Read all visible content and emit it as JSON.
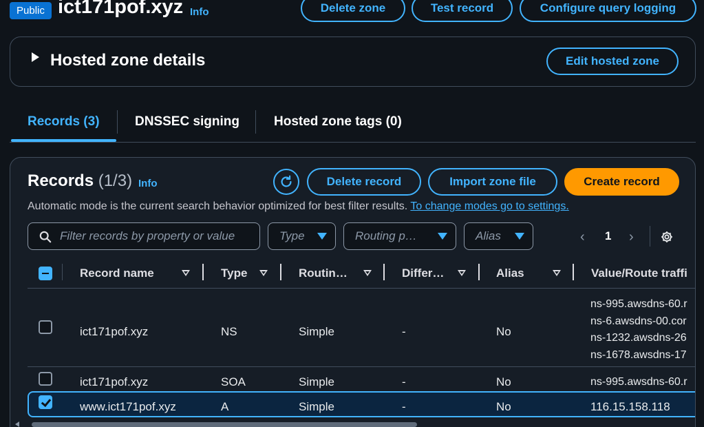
{
  "header": {
    "badge": "Public",
    "zone_name": "ict171pof.xyz",
    "info": "Info",
    "buttons": {
      "delete_zone": "Delete zone",
      "test_record": "Test record",
      "configure_query_logging": "Configure query logging"
    }
  },
  "details_panel": {
    "title": "Hosted zone details",
    "edit_button": "Edit hosted zone"
  },
  "tabs": [
    {
      "label": "Records (3)",
      "active": true
    },
    {
      "label": "DNSSEC signing",
      "active": false
    },
    {
      "label": "Hosted zone tags (0)",
      "active": false
    }
  ],
  "records": {
    "title": "Records",
    "count": "(1/3)",
    "info": "Info",
    "buttons": {
      "delete_record": "Delete record",
      "import_zone_file": "Import zone file",
      "create_record": "Create record"
    },
    "helper_text": "Automatic mode is the current search behavior optimized for best filter results.",
    "helper_link": "To change modes go to settings.",
    "filters": {
      "search_placeholder": "Filter records by property or value",
      "type": "Type",
      "routing": "Routing p…",
      "alias": "Alias"
    },
    "pagination": {
      "current_page": "1"
    },
    "columns": [
      "Record name",
      "Type",
      "Routin…",
      "Differ…",
      "Alias",
      "Value/Route traffi"
    ],
    "rows": [
      {
        "checked": false,
        "name": "ict171pof.xyz",
        "type": "NS",
        "routing": "Simple",
        "differentiator": "-",
        "alias": "No",
        "values": [
          "ns-995.awsdns-60.r",
          "ns-6.awsdns-00.cor",
          "ns-1232.awsdns-26",
          "ns-1678.awsdns-17"
        ]
      },
      {
        "checked": false,
        "name": "ict171pof.xyz",
        "type": "SOA",
        "routing": "Simple",
        "differentiator": "-",
        "alias": "No",
        "values": [
          "ns-995.awsdns-60.r"
        ]
      },
      {
        "checked": true,
        "name": "www.ict171pof.xyz",
        "type": "A",
        "routing": "Simple",
        "differentiator": "-",
        "alias": "No",
        "values": [
          "116.15.158.118"
        ]
      }
    ]
  },
  "colors": {
    "accent": "#42b4ff",
    "primary_button": "#ff9900",
    "badge": "#0972d3",
    "background": "#0f141a"
  }
}
